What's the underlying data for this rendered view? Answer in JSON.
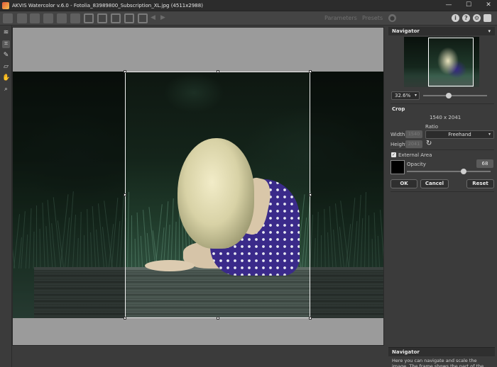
{
  "window": {
    "title": "AKVIS Watercolor v.6.0 - Fotolia_83989800_Subscription_XL.jpg (4511x2988)",
    "minimize": "—",
    "maximize": "☐",
    "close": "✕"
  },
  "toolbar": {
    "tab_parameters": "Parameters",
    "tab_presets": "Presets",
    "back_arrow": "◀",
    "forward_arrow": "▶",
    "info_icon": "i",
    "help_icon": "?",
    "settings_icon": "⚙",
    "notify_icon": "●"
  },
  "tools": [
    {
      "name": "watercolor-tool-icon",
      "glyph": "≋"
    },
    {
      "name": "crop-tool-icon",
      "glyph": "⌗"
    },
    {
      "name": "brush-tool-icon",
      "glyph": "✎"
    },
    {
      "name": "eraser-tool-icon",
      "glyph": "▱"
    },
    {
      "name": "hand-tool-icon",
      "glyph": "✋"
    },
    {
      "name": "zoom-tool-icon",
      "glyph": "⌕"
    }
  ],
  "navigator": {
    "title": "Navigator",
    "menu_icon": "▾",
    "zoom_value": "32.6%",
    "zoom_chevron": "▾",
    "zoom_slider": 0.4
  },
  "crop": {
    "title": "Crop",
    "size": "1540 x 2041",
    "ratio_label": "Ratio",
    "width_label": "Width",
    "height_label": "Height",
    "width_value": "1540",
    "height_value": "2041",
    "ratio_value": "Freehand",
    "ratio_chevron": "▾",
    "reset_icon": "↻",
    "external_area_label": "External Area",
    "external_area_checked": true,
    "external_area_check": "✓",
    "swatch_color": "#000000",
    "opacity_label": "Opacity",
    "opacity_value": "68",
    "opacity_fraction": 0.68,
    "ok_label": "OK",
    "cancel_label": "Cancel",
    "reset_label": "Reset"
  },
  "help": {
    "title": "Navigator",
    "text": "Here you can navigate and scale the image. The frame shows the part of the image that is"
  }
}
